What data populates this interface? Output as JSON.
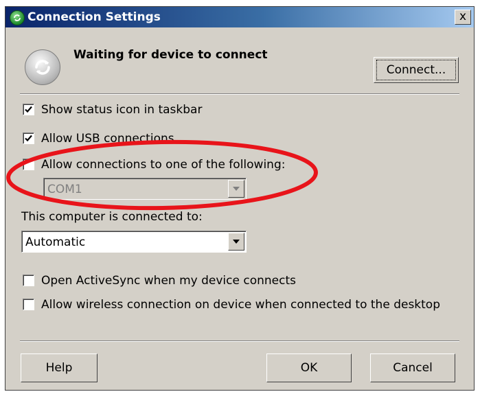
{
  "window": {
    "title": "Connection Settings",
    "close_label": "x"
  },
  "status": {
    "heading": "Waiting for device to connect",
    "connect_button_label": "Connect..."
  },
  "options": {
    "show_status_icon": {
      "label": "Show status icon in taskbar",
      "checked": true
    },
    "allow_usb": {
      "label": "Allow USB connections",
      "checked": true
    },
    "allow_connections_following": {
      "label": "Allow connections to one of the following:",
      "checked": false
    },
    "port_select": {
      "value": "COM1",
      "enabled": false
    }
  },
  "connected_to": {
    "label": "This computer is connected to:",
    "value": "Automatic"
  },
  "sync_options": {
    "open_activesync": {
      "label": "Open ActiveSync when my device connects",
      "checked": false
    },
    "allow_wireless": {
      "label": "Allow wireless connection on device when connected to the desktop",
      "checked": false
    }
  },
  "footer": {
    "help_label": "Help",
    "ok_label": "OK",
    "cancel_label": "Cancel"
  },
  "annotation": {
    "color": "#e8141a",
    "shape": "ellipse"
  },
  "icons": {
    "title": "activesync-icon",
    "status": "sync-arrows-icon",
    "close": "close-icon",
    "dropdown": "chevron-down-icon"
  }
}
